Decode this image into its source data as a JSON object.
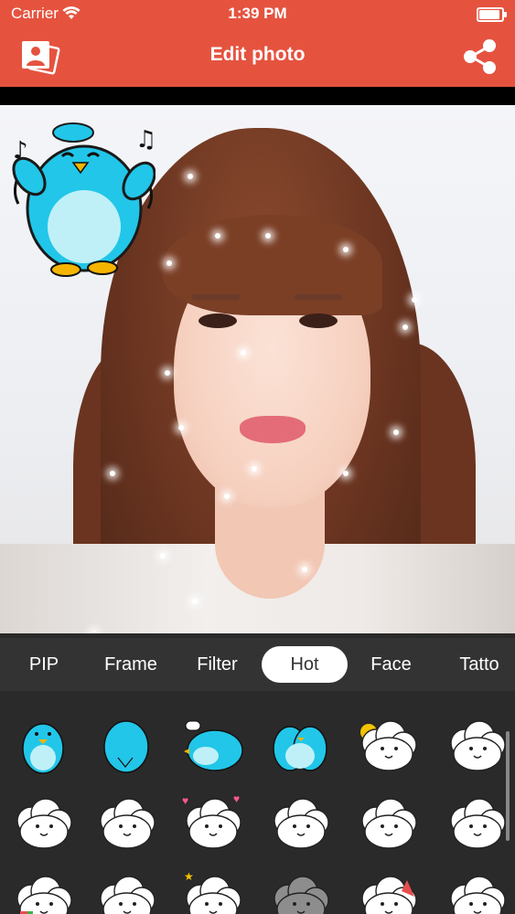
{
  "status_bar": {
    "carrier": "Carrier",
    "time": "1:39 PM"
  },
  "header": {
    "title": "Edit photo",
    "background": "#e5533f"
  },
  "icons": {
    "gallery": "gallery-icon",
    "share": "share-icon"
  },
  "tabs": [
    {
      "label": "PIP"
    },
    {
      "label": "Frame"
    },
    {
      "label": "Filter"
    },
    {
      "label": "Hot",
      "selected": true
    },
    {
      "label": "Face"
    },
    {
      "label": "Tatto"
    }
  ],
  "stickers": [
    {
      "kind": "blue",
      "variant": "penguin-front"
    },
    {
      "kind": "blue",
      "variant": "blob"
    },
    {
      "kind": "blue",
      "variant": "penguin-side"
    },
    {
      "kind": "blue",
      "variant": "penguin-pair"
    },
    {
      "kind": "cloud",
      "variant": "cloud-sun"
    },
    {
      "kind": "cloud",
      "variant": "cloud-think"
    },
    {
      "kind": "cloud",
      "variant": "cloud-fist"
    },
    {
      "kind": "cloud",
      "variant": "cloud-good"
    },
    {
      "kind": "cloud",
      "variant": "cloud-hearts"
    },
    {
      "kind": "cloud",
      "variant": "cloud-cry"
    },
    {
      "kind": "cloud",
      "variant": "cloud-dots"
    },
    {
      "kind": "cloud",
      "variant": "cloud-point"
    },
    {
      "kind": "cloud",
      "variant": "cloud-rainbow"
    },
    {
      "kind": "cloud",
      "variant": "cloud-plain"
    },
    {
      "kind": "cloud",
      "variant": "cloud-stars"
    },
    {
      "kind": "dark-cloud",
      "variant": "cloud-gray"
    },
    {
      "kind": "cloud",
      "variant": "cloud-party"
    },
    {
      "kind": "cloud",
      "variant": "cloud-wave"
    }
  ]
}
